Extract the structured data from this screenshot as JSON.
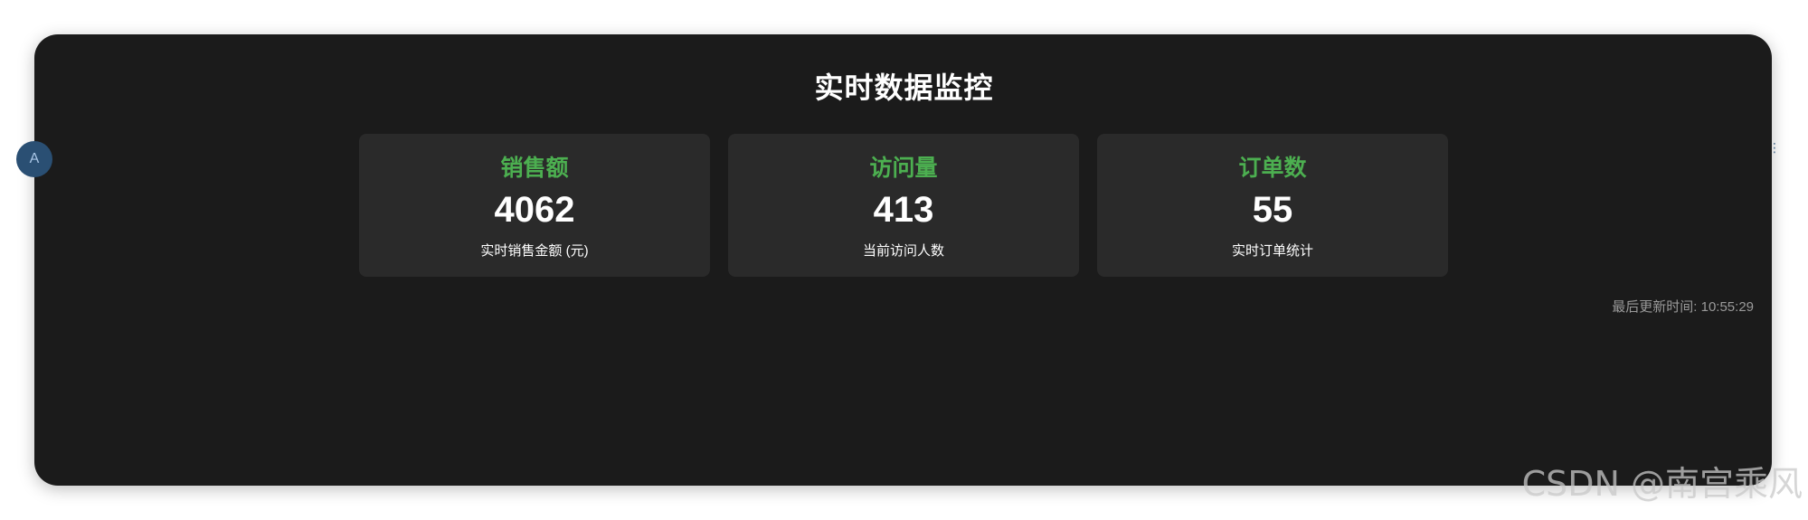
{
  "dashboard": {
    "title": "实时数据监控",
    "cards": [
      {
        "label": "销售额",
        "value": "4062",
        "desc": "实时销售金额 (元)"
      },
      {
        "label": "访问量",
        "value": "413",
        "desc": "当前访问人数"
      },
      {
        "label": "订单数",
        "value": "55",
        "desc": "实时订单统计"
      }
    ],
    "updated_label": "最后更新时间:",
    "updated_time": "10:55:29"
  },
  "left_badge": {
    "text": "A",
    "icon": "translate-icon"
  },
  "watermark": "CSDN @南宫乘风",
  "colors": {
    "panel_bg": "#1b1b1b",
    "card_bg": "#2a2a2a",
    "accent": "#4caf50",
    "text": "#ffffff",
    "muted": "#9a9a9a"
  }
}
